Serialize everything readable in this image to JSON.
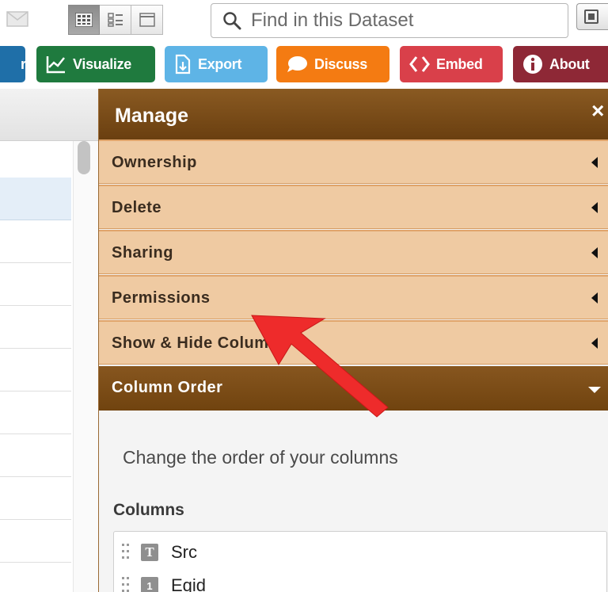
{
  "toolbar": {
    "search": {
      "placeholder": "Find in this Dataset",
      "value": ""
    }
  },
  "actions": {
    "partial_label": "r",
    "visualize": "Visualize",
    "export": "Export",
    "discuss": "Discuss",
    "embed": "Embed",
    "about": "About"
  },
  "panel": {
    "title": "Manage",
    "close": "×",
    "sections": [
      {
        "label": "Ownership"
      },
      {
        "label": "Delete"
      },
      {
        "label": "Sharing"
      },
      {
        "label": "Permissions"
      },
      {
        "label": "Show & Hide Columns"
      }
    ],
    "open_section": {
      "label": "Column Order",
      "description": "Change the order of your columns",
      "columns_label": "Columns",
      "columns": [
        {
          "name": "Src",
          "type_icon": "text-type-icon",
          "glyph": "T"
        },
        {
          "name": "Eqid",
          "type_icon": "number-type-icon",
          "glyph": "1"
        }
      ]
    }
  },
  "colors": {
    "visualize": "#1f7a3e",
    "export": "#5eb4e6",
    "discuss": "#f47b12",
    "embed": "#d9404a",
    "about": "#8e2836",
    "panel_header": "#7a4a18",
    "section_bg": "#efcaa2",
    "annotation_arrow": "#ee2b2b"
  }
}
